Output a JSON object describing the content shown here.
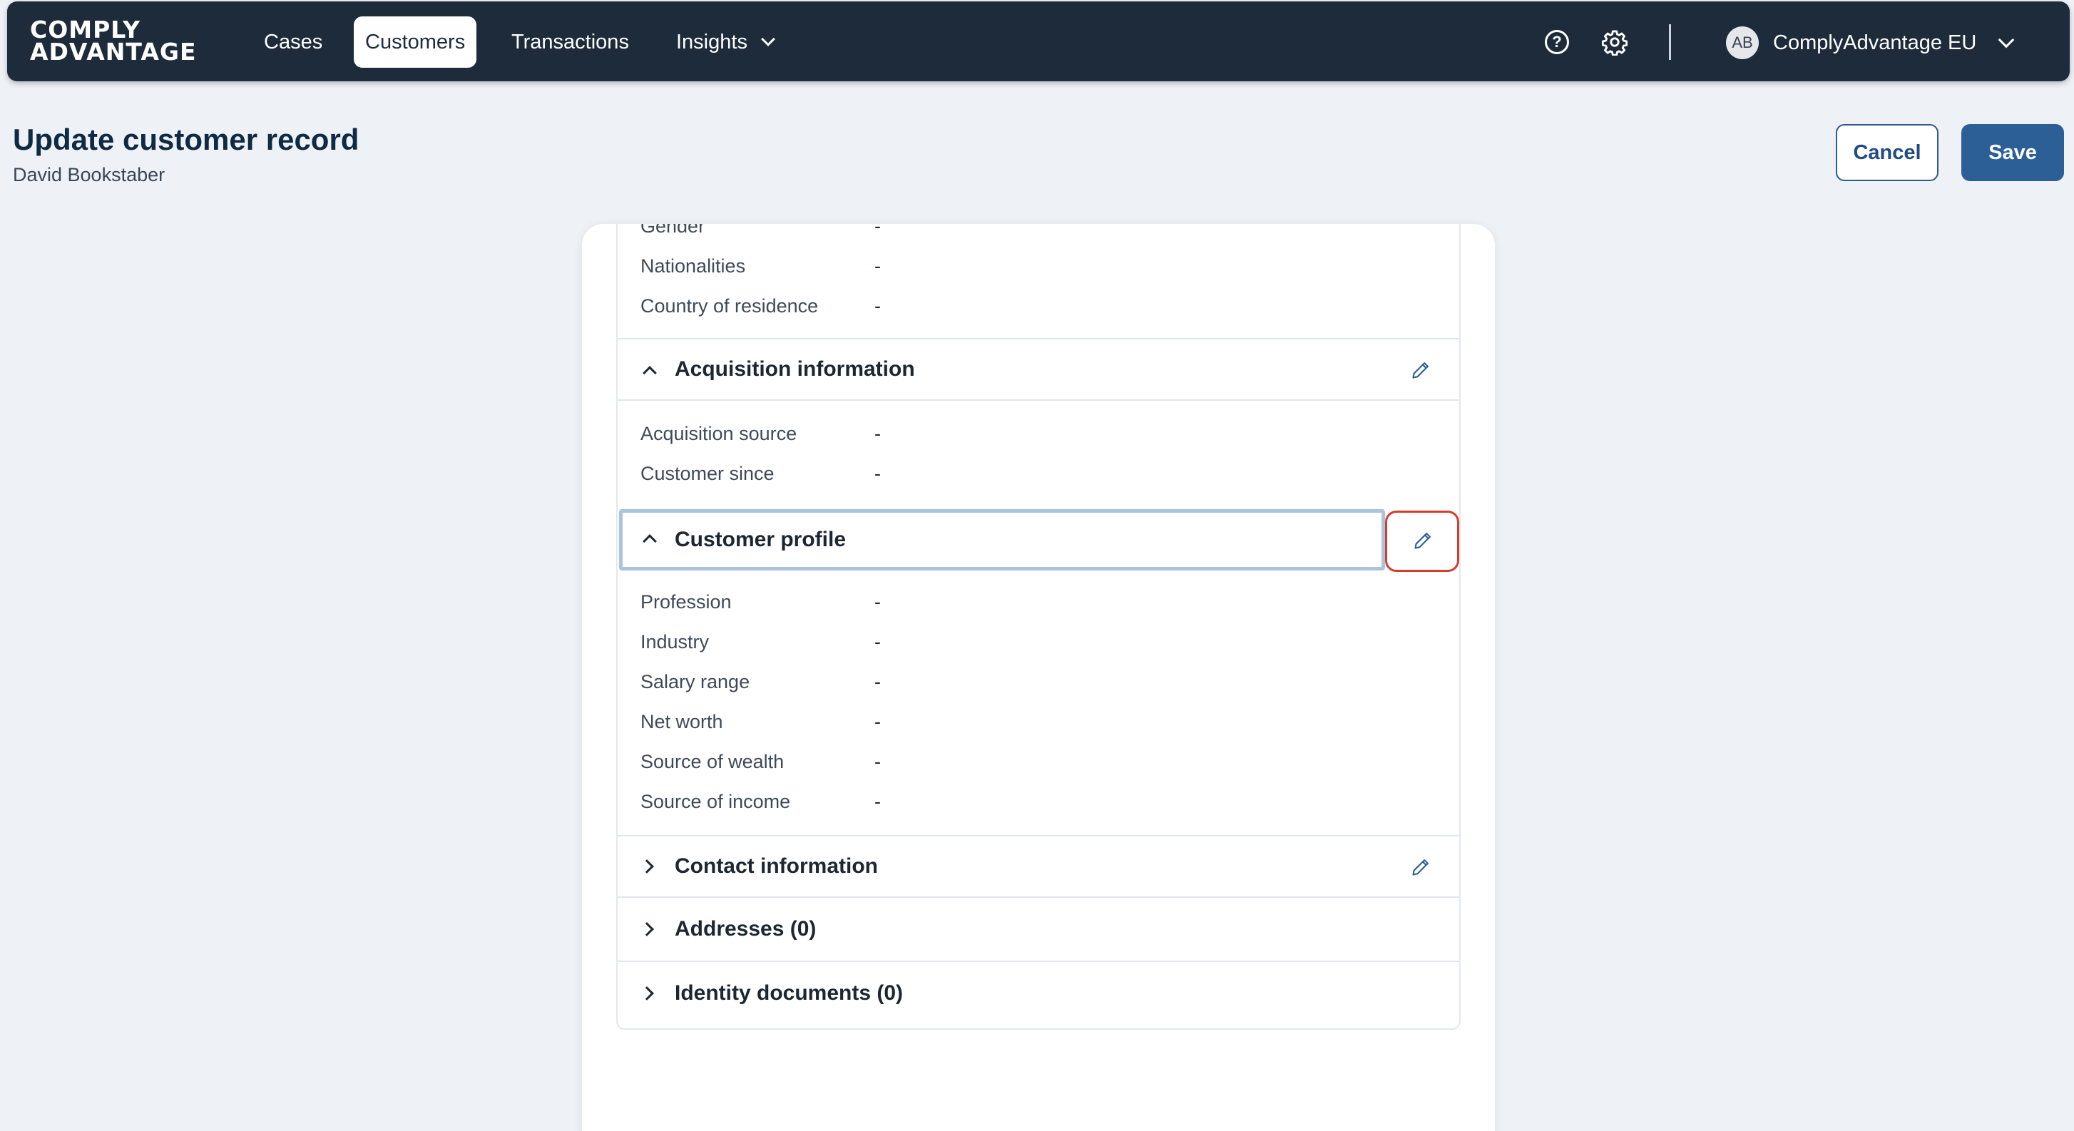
{
  "brand": {
    "line1": "COMPLY",
    "line2": "ADVANTAGE"
  },
  "nav": {
    "items": [
      {
        "label": "Cases"
      },
      {
        "label": "Customers"
      },
      {
        "label": "Transactions"
      },
      {
        "label": "Insights"
      }
    ],
    "help_icon": "question-circle-icon",
    "settings_icon": "gear-icon",
    "account": {
      "initials": "AB",
      "name": "ComplyAdvantage EU"
    }
  },
  "header": {
    "title": "Update customer record",
    "subtitle": "David Bookstaber",
    "cancel_label": "Cancel",
    "save_label": "Save"
  },
  "personal_fields": [
    {
      "label": "Gender",
      "value": "-"
    },
    {
      "label": "Nationalities",
      "value": "-"
    },
    {
      "label": "Country of residence",
      "value": "-"
    }
  ],
  "sections": {
    "acquisition": {
      "title": "Acquisition information",
      "fields": [
        {
          "label": "Acquisition source",
          "value": "-"
        },
        {
          "label": "Customer since",
          "value": "-"
        }
      ]
    },
    "profile": {
      "title": "Customer profile",
      "fields": [
        {
          "label": "Profession",
          "value": "-"
        },
        {
          "label": "Industry",
          "value": "-"
        },
        {
          "label": "Salary range",
          "value": "-"
        },
        {
          "label": "Net worth",
          "value": "-"
        },
        {
          "label": "Source of wealth",
          "value": "-"
        },
        {
          "label": "Source of income",
          "value": "-"
        }
      ]
    },
    "contact": {
      "title": "Contact information"
    },
    "addresses": {
      "title": "Addresses (0)"
    },
    "identity": {
      "title": "Identity documents (0)"
    }
  },
  "colors": {
    "nav_bg": "#1d2b3a",
    "primary": "#2b5f96",
    "focus_outline": "#a9c4dc",
    "highlight_red": "#d63c2e"
  }
}
